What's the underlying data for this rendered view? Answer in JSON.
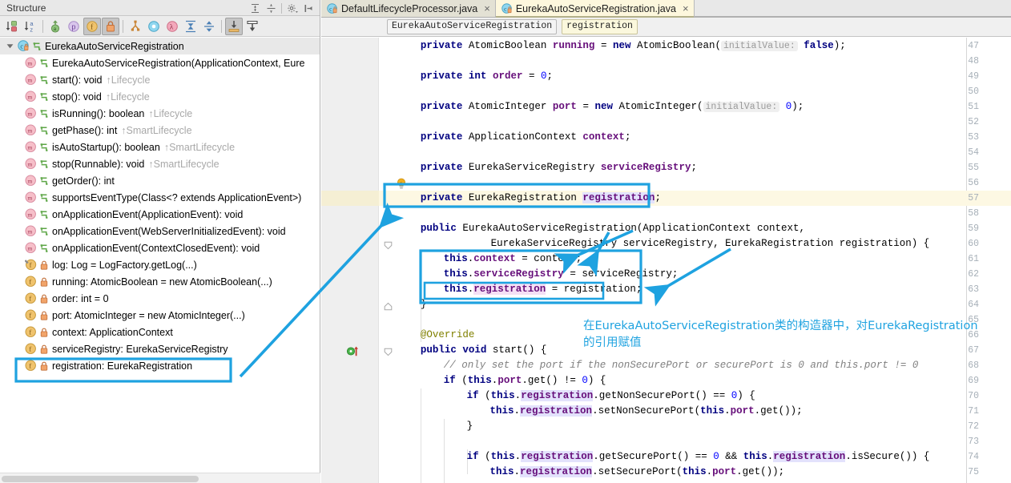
{
  "structure": {
    "title": "Structure",
    "header_icons": [
      {
        "name": "expand-all-icon",
        "glyph": "⬍"
      },
      {
        "name": "collapse-all-icon",
        "glyph": "⬍"
      },
      {
        "name": "settings-gear-icon",
        "glyph": "⚙"
      },
      {
        "name": "hide-panel-icon",
        "glyph": "⇤"
      }
    ],
    "toolbar_buttons": [
      {
        "name": "sort-by-visibility-button",
        "label": "↓",
        "badge": "b",
        "selected": false
      },
      {
        "name": "sort-alphabetically-button",
        "label": "↓",
        "badge": "az",
        "selected": false
      },
      {
        "name": "show-inherited-button",
        "label": "↑",
        "selected": false
      },
      {
        "name": "show-properties-button",
        "label": "p",
        "selected": false
      },
      {
        "name": "show-fields-button",
        "label": "f",
        "selected": true
      },
      {
        "name": "show-non-public-button",
        "label": "🔒",
        "selected": true
      },
      {
        "name": "show-anonymous-classes-button",
        "label": "⑂",
        "selected": false
      },
      {
        "name": "show-interfaces-button",
        "label": "○",
        "selected": false
      },
      {
        "name": "show-lambdas-button",
        "label": "λ",
        "selected": false
      },
      {
        "name": "expand-all-button",
        "label": "↧",
        "selected": false
      },
      {
        "name": "collapse-all-button",
        "label": "↥",
        "selected": false
      },
      {
        "name": "autoscroll-to-source-button",
        "label": "⤓",
        "selected": true
      },
      {
        "name": "autoscroll-from-source-button",
        "label": "⤓",
        "selected": false
      }
    ],
    "tree": [
      {
        "icon": "class-icon",
        "vis": "vis-package",
        "label": "EurekaAutoServiceRegistration",
        "owner": "",
        "depth": 0,
        "selected": true,
        "highlighted": false
      },
      {
        "icon": "method-icon",
        "vis": "vis-package",
        "label": "EurekaAutoServiceRegistration(ApplicationContext, Eure",
        "owner": "",
        "depth": 1,
        "selected": false,
        "highlighted": false
      },
      {
        "icon": "method-icon",
        "vis": "vis-package",
        "label": "start(): void",
        "owner": "↑Lifecycle",
        "depth": 1,
        "selected": false,
        "highlighted": false
      },
      {
        "icon": "method-icon",
        "vis": "vis-package",
        "label": "stop(): void",
        "owner": "↑Lifecycle",
        "depth": 1,
        "selected": false,
        "highlighted": false
      },
      {
        "icon": "method-icon",
        "vis": "vis-package",
        "label": "isRunning(): boolean",
        "owner": "↑Lifecycle",
        "depth": 1,
        "selected": false,
        "highlighted": false
      },
      {
        "icon": "method-icon",
        "vis": "vis-package",
        "label": "getPhase(): int",
        "owner": "↑SmartLifecycle",
        "depth": 1,
        "selected": false,
        "highlighted": false
      },
      {
        "icon": "method-icon",
        "vis": "vis-package",
        "label": "isAutoStartup(): boolean",
        "owner": "↑SmartLifecycle",
        "depth": 1,
        "selected": false,
        "highlighted": false
      },
      {
        "icon": "method-icon",
        "vis": "vis-package",
        "label": "stop(Runnable): void",
        "owner": "↑SmartLifecycle",
        "depth": 1,
        "selected": false,
        "highlighted": false
      },
      {
        "icon": "method-icon",
        "vis": "vis-package",
        "label": "getOrder(): int",
        "owner": "",
        "depth": 1,
        "selected": false,
        "highlighted": false
      },
      {
        "icon": "method-icon",
        "vis": "vis-package",
        "label": "supportsEventType(Class<? extends ApplicationEvent>)",
        "owner": "",
        "depth": 1,
        "selected": false,
        "highlighted": false
      },
      {
        "icon": "method-icon",
        "vis": "vis-package",
        "label": "onApplicationEvent(ApplicationEvent): void",
        "owner": "",
        "depth": 1,
        "selected": false,
        "highlighted": false
      },
      {
        "icon": "method-icon",
        "vis": "vis-package",
        "label": "onApplicationEvent(WebServerInitializedEvent): void",
        "owner": "",
        "depth": 1,
        "selected": false,
        "highlighted": false
      },
      {
        "icon": "method-icon",
        "vis": "vis-package",
        "label": "onApplicationEvent(ContextClosedEvent): void",
        "owner": "",
        "depth": 1,
        "selected": false,
        "highlighted": false
      },
      {
        "icon": "static-field-icon",
        "vis": "vis-private",
        "label": "log: Log = LogFactory.getLog(...)",
        "owner": "",
        "depth": 1,
        "selected": false,
        "highlighted": false
      },
      {
        "icon": "field-icon",
        "vis": "vis-private",
        "label": "running: AtomicBoolean = new AtomicBoolean(...)",
        "owner": "",
        "depth": 1,
        "selected": false,
        "highlighted": false
      },
      {
        "icon": "field-icon",
        "vis": "vis-private",
        "label": "order: int = 0",
        "owner": "",
        "depth": 1,
        "selected": false,
        "highlighted": false
      },
      {
        "icon": "field-icon",
        "vis": "vis-private",
        "label": "port: AtomicInteger = new AtomicInteger(...)",
        "owner": "",
        "depth": 1,
        "selected": false,
        "highlighted": false
      },
      {
        "icon": "field-icon",
        "vis": "vis-private",
        "label": "context: ApplicationContext",
        "owner": "",
        "depth": 1,
        "selected": false,
        "highlighted": false
      },
      {
        "icon": "field-icon",
        "vis": "vis-private",
        "label": "serviceRegistry: EurekaServiceRegistry",
        "owner": "",
        "depth": 1,
        "selected": false,
        "highlighted": false
      },
      {
        "icon": "field-icon",
        "vis": "vis-private",
        "label": "registration: EurekaRegistration",
        "owner": "",
        "depth": 1,
        "selected": false,
        "highlighted": true
      }
    ]
  },
  "editor": {
    "tabs": [
      {
        "name": "tab-default-lifecycle-processor",
        "label": "DefaultLifecycleProcessor.java",
        "active": false,
        "close": "×"
      },
      {
        "name": "tab-eureka-auto-service-registration",
        "label": "EurekaAutoServiceRegistration.java",
        "active": true,
        "close": "×"
      }
    ],
    "breadcrumbs": [
      {
        "name": "breadcrumb-class",
        "label": "EurekaAutoServiceRegistration",
        "current": false
      },
      {
        "name": "breadcrumb-field",
        "label": "registration",
        "current": true
      }
    ],
    "first_line_number": 47,
    "last_line_number": 75,
    "highlighted_line": 57,
    "lines": [
      {
        "n": 47,
        "indent": 4,
        "html": "<span class=\"kw\">private</span> AtomicBoolean <span class=\"fld\">running</span> = <span class=\"kw\">new</span> AtomicBoolean(<span class=\"hint\">initialValue:</span> <span class=\"kw\">false</span>);"
      },
      {
        "n": 48,
        "indent": 0,
        "html": ""
      },
      {
        "n": 49,
        "indent": 4,
        "html": "<span class=\"kw\">private</span> <span class=\"kw\">int</span> <span class=\"fld\">order</span> = <span class=\"num\">0</span>;"
      },
      {
        "n": 50,
        "indent": 0,
        "html": ""
      },
      {
        "n": 51,
        "indent": 4,
        "html": "<span class=\"kw\">private</span> AtomicInteger <span class=\"fld\">port</span> = <span class=\"kw\">new</span> AtomicInteger(<span class=\"hint\">initialValue:</span> <span class=\"num\">0</span>);"
      },
      {
        "n": 52,
        "indent": 0,
        "html": ""
      },
      {
        "n": 53,
        "indent": 4,
        "html": "<span class=\"kw\">private</span> ApplicationContext <span class=\"fld\">context</span>;"
      },
      {
        "n": 54,
        "indent": 0,
        "html": ""
      },
      {
        "n": 55,
        "indent": 4,
        "html": "<span class=\"kw\">private</span> EurekaServiceRegistry <span class=\"fld\">serviceRegistry</span>;"
      },
      {
        "n": 56,
        "indent": 0,
        "html": ""
      },
      {
        "n": 57,
        "indent": 4,
        "html": "<span class=\"kw\">private</span> EurekaRegistration <span class=\"fld usehl\">registration</span>;"
      },
      {
        "n": 58,
        "indent": 0,
        "html": ""
      },
      {
        "n": 59,
        "indent": 4,
        "html": "<span class=\"kw\">public</span> EurekaAutoServiceRegistration(ApplicationContext context,"
      },
      {
        "n": 60,
        "indent": 12,
        "html": "    EurekaServiceRegistry serviceRegistry, EurekaRegistration registration) {"
      },
      {
        "n": 61,
        "indent": 8,
        "html": "<span class=\"kw\">this</span>.<span class=\"fld\">context</span> = context;"
      },
      {
        "n": 62,
        "indent": 8,
        "html": "<span class=\"kw\">this</span>.<span class=\"fld\">serviceRegistry</span> = serviceRegistry;"
      },
      {
        "n": 63,
        "indent": 8,
        "html": "<span class=\"kw\">this</span>.<span class=\"fld usehl2\">registration</span> = registration;"
      },
      {
        "n": 64,
        "indent": 4,
        "html": "}"
      },
      {
        "n": 65,
        "indent": 0,
        "html": ""
      },
      {
        "n": 66,
        "indent": 4,
        "html": "<span class=\"ann\">@Override</span>"
      },
      {
        "n": 67,
        "indent": 4,
        "html": "<span class=\"kw\">public</span> <span class=\"kw\">void</span> start() {"
      },
      {
        "n": 68,
        "indent": 8,
        "html": "<span class=\"cmt\">// only set the port if the nonSecurePort or securePort is 0 and this.port != 0</span>"
      },
      {
        "n": 69,
        "indent": 8,
        "html": "<span class=\"kw\">if</span> (<span class=\"kw\">this</span>.<span class=\"fld\">port</span>.get() != <span class=\"num\">0</span>) {"
      },
      {
        "n": 70,
        "indent": 12,
        "html": "<span class=\"kw\">if</span> (<span class=\"kw\">this</span>.<span class=\"fld usehl\">registration</span>.getNonSecurePort() == <span class=\"num\">0</span>) {"
      },
      {
        "n": 71,
        "indent": 16,
        "html": "<span class=\"kw\">this</span>.<span class=\"fld usehl\">registration</span>.setNonSecurePort(<span class=\"kw\">this</span>.<span class=\"fld\">port</span>.get());"
      },
      {
        "n": 72,
        "indent": 12,
        "html": "}"
      },
      {
        "n": 73,
        "indent": 0,
        "html": ""
      },
      {
        "n": 74,
        "indent": 12,
        "html": "<span class=\"kw\">if</span> (<span class=\"kw\">this</span>.<span class=\"fld usehl\">registration</span>.getSecurePort() == <span class=\"num\">0</span> &amp;&amp; <span class=\"kw\">this</span>.<span class=\"fld usehl\">registration</span>.isSecure()) {"
      },
      {
        "n": 75,
        "indent": 16,
        "html": "<span class=\"kw\">this</span>.<span class=\"fld usehl\">registration</span>.setSecurePort(<span class=\"kw\">this</span>.<span class=\"fld\">port</span>.get());"
      }
    ]
  },
  "annotation": {
    "note_line_1": "在EurekaAutoServiceRegistration类的构造器中，对EurekaRegistration",
    "note_line_2": "的引用赋值",
    "accent_color": "#1ea2e0"
  }
}
